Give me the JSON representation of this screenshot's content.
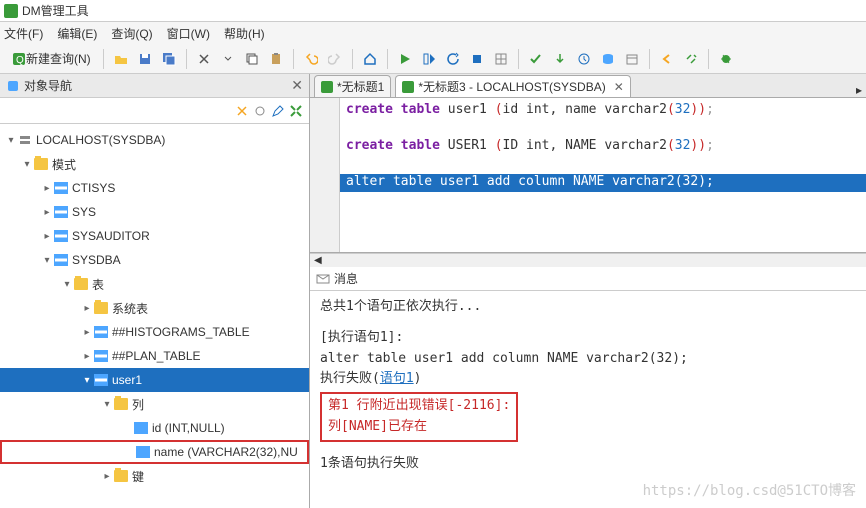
{
  "app": {
    "title": "DM管理工具"
  },
  "menu": {
    "file": "文件(F)",
    "edit": "编辑(E)",
    "query": "查询(Q)",
    "window": "窗口(W)",
    "help": "帮助(H)"
  },
  "toolbar": {
    "new_query": "新建查询(N)"
  },
  "nav": {
    "title": "对象导航",
    "server": "LOCALHOST(SYSDBA)",
    "schema": "模式",
    "ctisys": "CTISYS",
    "sys": "SYS",
    "sysauditor": "SYSAUDITOR",
    "sysdba": "SYSDBA",
    "tables": "表",
    "systable": "系统表",
    "histograms": "##HISTOGRAMS_TABLE",
    "plan": "##PLAN_TABLE",
    "user1": "user1",
    "columns": "列",
    "col_id": "id (INT,NULL)",
    "col_name": "name (VARCHAR2(32),NU",
    "keys": "键"
  },
  "tabs": {
    "tab1": "*无标题1",
    "tab2": "*无标题3 - LOCALHOST(SYSDBA)"
  },
  "editor": {
    "line1_pre": "create table ",
    "line1_name": "user1 ",
    "line1_col1": "id ",
    "line1_t1": "int",
    "line1_comma": ", ",
    "line1_col2": "name ",
    "line1_t2": "varchar2",
    "line1_n": "32",
    "line3_pre": "create table ",
    "line3_name": "USER1 ",
    "line3_col1": "ID ",
    "line3_t1": "int",
    "line3_col2": "NAME ",
    "line3_t2": "varchar2",
    "line3_n": "32",
    "line5": "alter table user1 add column NAME varchar2(32);"
  },
  "messages": {
    "header": "消息",
    "summary": "总共1个语句正依次执行...",
    "exec_label": "[执行语句1]:",
    "exec_sql": "alter table user1 add column NAME varchar2(32);",
    "fail_prefix": "执行失败(",
    "fail_link": "语句1",
    "fail_suffix": ")",
    "err1": "第1 行附近出现错误[-2116]:",
    "err2": "列[NAME]已存在",
    "footer": "1条语句执行失败"
  },
  "watermark": "https://blog.csd@51CTO博客"
}
